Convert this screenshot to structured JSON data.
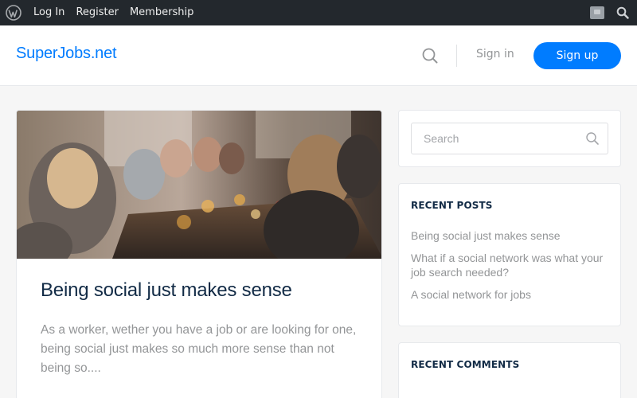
{
  "adminbar": {
    "items": [
      {
        "label": "Log In"
      },
      {
        "label": "Register"
      },
      {
        "label": "Membership"
      }
    ]
  },
  "header": {
    "site_title": "SuperJobs.net",
    "signin_label": "Sign in",
    "signup_label": "Sign up",
    "accent_color": "#007cff"
  },
  "post": {
    "title": "Being social just makes sense",
    "excerpt": "As a worker, wether you have a job or are looking for one, being social just makes so much more sense than not being so...."
  },
  "sidebar": {
    "search": {
      "placeholder": "Search"
    },
    "recent_posts": {
      "title": "RECENT POSTS",
      "items": [
        {
          "label": "Being social just makes sense"
        },
        {
          "label": "What if a social network was what your job search needed?"
        },
        {
          "label": "A social network for jobs"
        }
      ]
    },
    "recent_comments": {
      "title": "RECENT COMMENTS"
    }
  }
}
